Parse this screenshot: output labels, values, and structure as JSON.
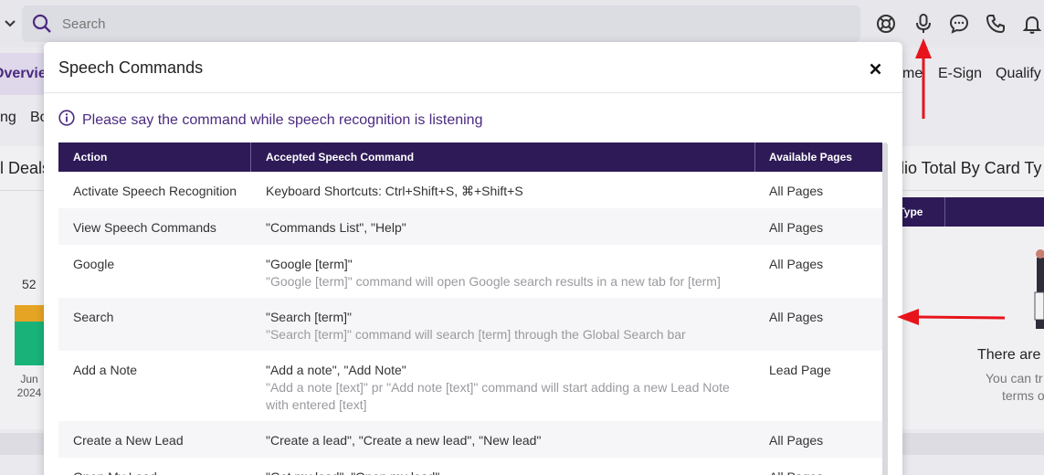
{
  "topbar": {
    "search_placeholder": "Search",
    "icons": [
      "chevron-down-icon",
      "search-icon",
      "support-icon",
      "microphone-icon",
      "chat-icon",
      "phone-icon",
      "bell-icon"
    ]
  },
  "background": {
    "nav_active": "Overview",
    "nav_right": [
      "me",
      "E-Sign",
      "Qualify"
    ],
    "subnav": [
      "ng",
      "Bo"
    ],
    "left_panel_title": "l Deals",
    "bar_value": "52",
    "axis_month": "Jun",
    "axis_year": "2024",
    "right_panel_title": "lio Total By Card Ty",
    "card_type_header": "rd Type",
    "empty_title": "There are",
    "empty_sub_1": "You can tr",
    "empty_sub_2": "terms o"
  },
  "modal": {
    "title": "Speech Commands",
    "info": "Please say the command while speech recognition is listening",
    "columns": [
      "Action",
      "Accepted Speech Command",
      "Available Pages"
    ],
    "rows": [
      {
        "action": "Activate Speech Recognition",
        "command": "Keyboard Shortcuts: Ctrl+Shift+S, ⌘+Shift+S",
        "description": "",
        "pages": "All Pages"
      },
      {
        "action": "View Speech Commands",
        "command": "\"Commands List\", \"Help\"",
        "description": "",
        "pages": "All Pages"
      },
      {
        "action": "Google",
        "command": "\"Google [term]\"",
        "description": "\"Google [term]\" command will open Google search results in a new tab for [term]",
        "pages": "All Pages"
      },
      {
        "action": "Search",
        "command": "\"Search [term]\"",
        "description": "\"Search [term]\" command will search [term] through the Global Search bar",
        "pages": "All Pages"
      },
      {
        "action": "Add a Note",
        "command": "\"Add a note\", \"Add Note\"",
        "description": "\"Add a note [text]\" pr \"Add note [text]\" command will start adding a new Lead Note with entered [text]",
        "pages": "Lead Page"
      },
      {
        "action": "Create a New Lead",
        "command": "\"Create a lead\", \"Create a new lead\", \"New lead\"",
        "description": "",
        "pages": "All Pages"
      },
      {
        "action": "Open My Lead",
        "command": "\"Get my lead\", \"Open my lead\"",
        "description": "",
        "pages": "All Pages"
      }
    ]
  },
  "colors": {
    "header_bg": "#2d1a57",
    "accent": "#4b2a80",
    "arrow": "#e8141c"
  }
}
